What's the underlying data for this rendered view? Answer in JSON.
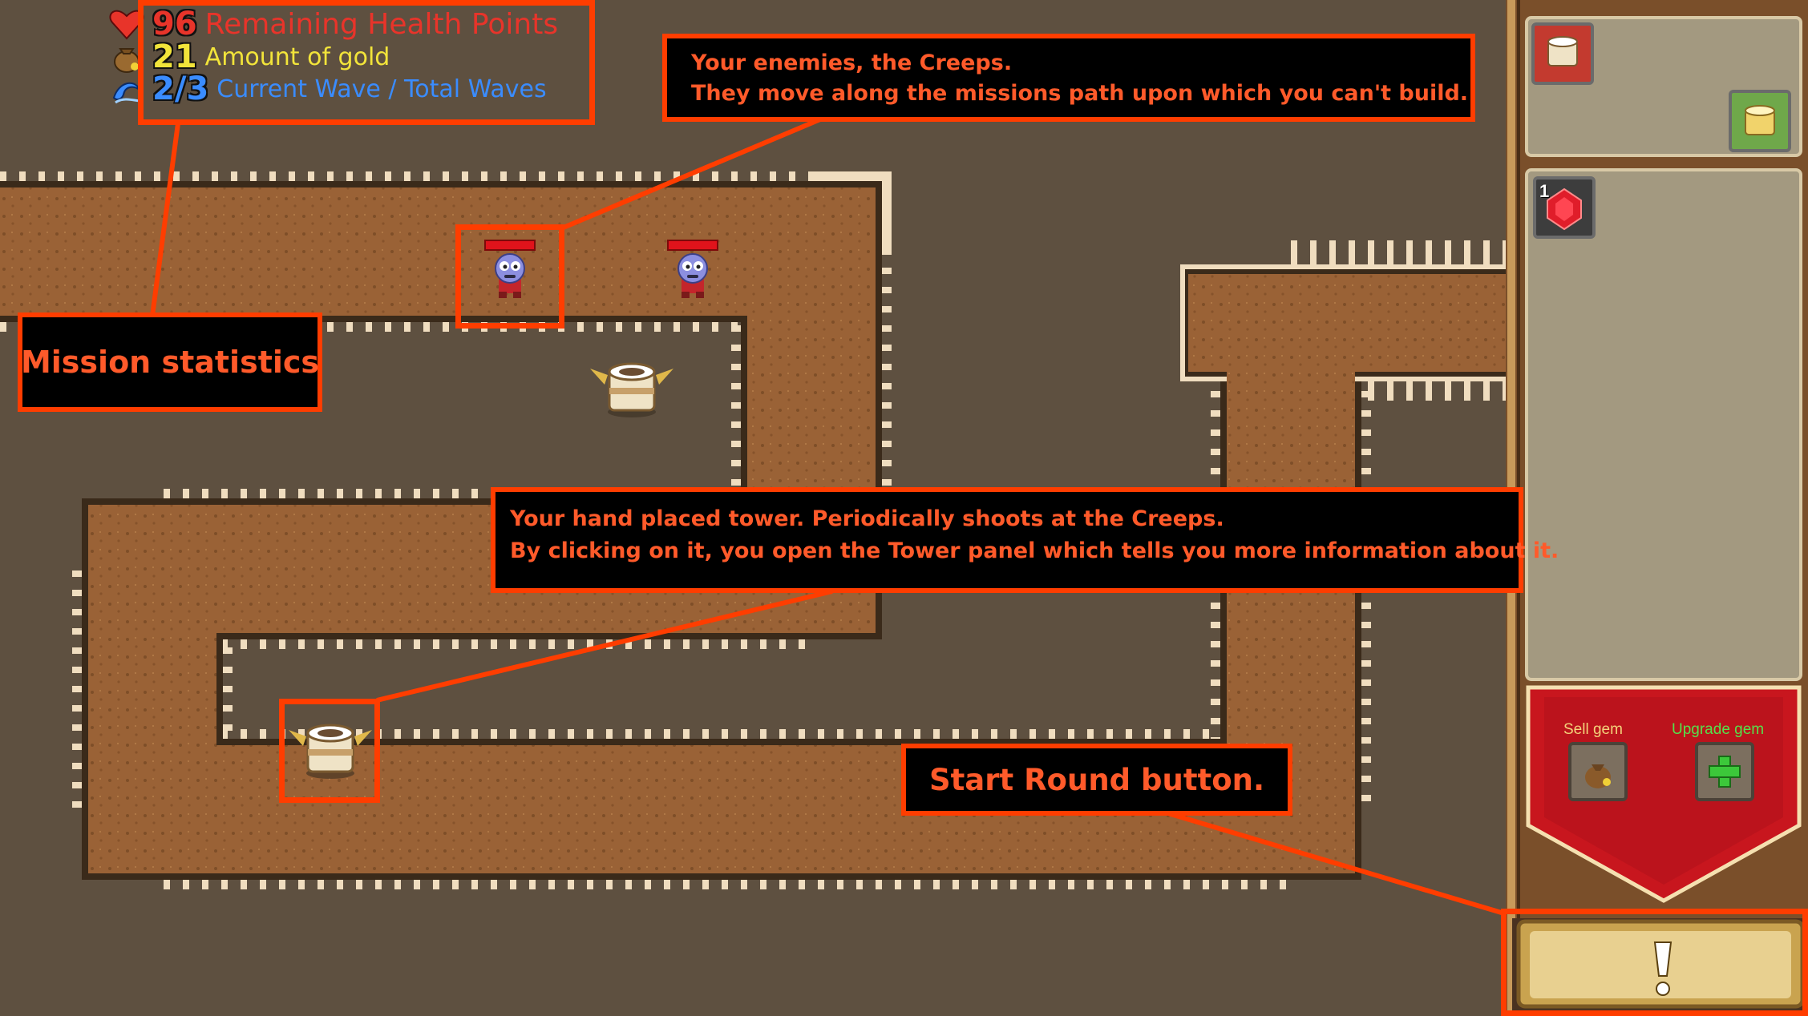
{
  "hud": {
    "health_value": "96",
    "health_label": "Remaining Health Points",
    "gold_value": "21",
    "gold_label": "Amount of gold",
    "wave_value": "2/3",
    "wave_label": "Current Wave / Total Waves"
  },
  "annotations": {
    "mission_stats": "Mission statistics",
    "creeps_line1": "Your enemies, the Creeps.",
    "creeps_line2": "They move along the missions path upon which you can't build.",
    "tower_line1": "Your hand placed tower. Periodically shoots at the Creeps.",
    "tower_line2": "By clicking on it, you open the Tower panel which tells you more information about it.",
    "start_round": "Start Round button."
  },
  "side_panel": {
    "gem_count": "1",
    "sell_gem_label": "Sell gem",
    "upgrade_gem_label": "Upgrade gem",
    "start_button_glyph": "!"
  },
  "icons": [
    "heart-icon",
    "gold-bag-icon",
    "wave-icon",
    "tower-icon",
    "creep-icon",
    "ruby-gem-icon",
    "plus-icon",
    "exclamation-icon"
  ],
  "colors": {
    "accent": "#ff3d00",
    "annotation_text": "#ff5a2a",
    "health": "#e8342a",
    "gold": "#f2e43a",
    "wave": "#3a8cff",
    "sell_label": "#f3d27a",
    "upgrade_label": "#55e04b",
    "path": "#9a6236",
    "ground": "#5e5040"
  }
}
